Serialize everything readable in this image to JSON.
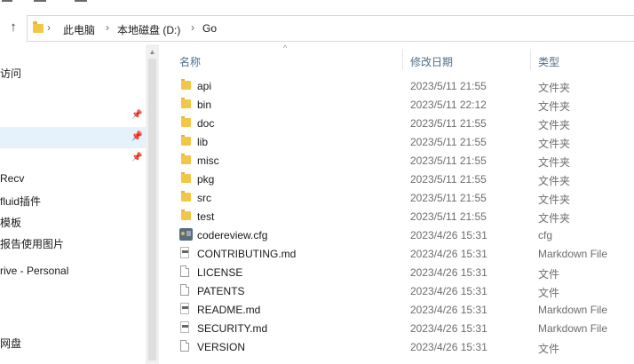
{
  "address": {
    "crumbs": [
      "此电脑",
      "本地磁盘 (D:)",
      "Go"
    ]
  },
  "nav": {
    "items": [
      "访问",
      "Recv",
      "fluid插件",
      "模板",
      "报告使用图片",
      "rive - Personal",
      "网盘"
    ]
  },
  "columns": {
    "name": "名称",
    "date": "修改日期",
    "type": "类型"
  },
  "files": [
    {
      "name": "api",
      "date": "2023/5/11 21:55",
      "type": "文件夹",
      "icon": "folder-icon"
    },
    {
      "name": "bin",
      "date": "2023/5/11 22:12",
      "type": "文件夹",
      "icon": "folder-icon"
    },
    {
      "name": "doc",
      "date": "2023/5/11 21:55",
      "type": "文件夹",
      "icon": "folder-icon"
    },
    {
      "name": "lib",
      "date": "2023/5/11 21:55",
      "type": "文件夹",
      "icon": "folder-icon"
    },
    {
      "name": "misc",
      "date": "2023/5/11 21:55",
      "type": "文件夹",
      "icon": "folder-icon"
    },
    {
      "name": "pkg",
      "date": "2023/5/11 21:55",
      "type": "文件夹",
      "icon": "folder-icon"
    },
    {
      "name": "src",
      "date": "2023/5/11 21:55",
      "type": "文件夹",
      "icon": "folder-icon"
    },
    {
      "name": "test",
      "date": "2023/5/11 21:55",
      "type": "文件夹",
      "icon": "folder-icon"
    },
    {
      "name": "codereview.cfg",
      "date": "2023/4/26 15:31",
      "type": "cfg",
      "icon": "cfg-file-icon"
    },
    {
      "name": "CONTRIBUTING.md",
      "date": "2023/4/26 15:31",
      "type": "Markdown File",
      "icon": "markdown-file-icon"
    },
    {
      "name": "LICENSE",
      "date": "2023/4/26 15:31",
      "type": "文件",
      "icon": "file-icon"
    },
    {
      "name": "PATENTS",
      "date": "2023/4/26 15:31",
      "type": "文件",
      "icon": "file-icon"
    },
    {
      "name": "README.md",
      "date": "2023/4/26 15:31",
      "type": "Markdown File",
      "icon": "markdown-file-icon"
    },
    {
      "name": "SECURITY.md",
      "date": "2023/4/26 15:31",
      "type": "Markdown File",
      "icon": "markdown-file-icon"
    },
    {
      "name": "VERSION",
      "date": "2023/4/26 15:31",
      "type": "文件",
      "icon": "file-icon"
    }
  ],
  "colors": {
    "selection": "#e5f1fb",
    "folder": "#f3c745",
    "header_text": "#4d6f8c"
  }
}
